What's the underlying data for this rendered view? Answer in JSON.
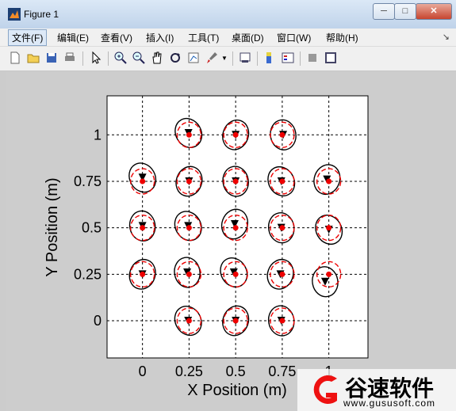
{
  "window": {
    "title": "Figure 1",
    "minimize": "─",
    "maximize": "□",
    "close": "✕"
  },
  "menu": [
    {
      "label": "文件(F)"
    },
    {
      "label": "编辑(E)"
    },
    {
      "label": "查看(V)"
    },
    {
      "label": "插入(I)"
    },
    {
      "label": "工具(T)"
    },
    {
      "label": "桌面(D)"
    },
    {
      "label": "窗口(W)"
    },
    {
      "label": "帮助(H)"
    }
  ],
  "toolbar_icons": [
    "new-icon",
    "open-icon",
    "save-icon",
    "print-icon",
    "pointer-icon",
    "zoom-in-icon",
    "zoom-out-icon",
    "pan-icon",
    "rotate-icon",
    "datacursor-icon",
    "brush-icon",
    "link-icon",
    "colorbar-icon",
    "legend-icon",
    "hide-tools-icon",
    "show-tools-icon"
  ],
  "chart_data": {
    "type": "scatter",
    "xlabel": "X Position (m)",
    "ylabel": "Y Position (m)",
    "xticks": [
      "0",
      "0.25",
      "0.5",
      "0.75",
      "1"
    ],
    "yticks": [
      "0",
      "0.25",
      "0.5",
      "0.75",
      "1"
    ],
    "xlim": [
      -0.19,
      1.21
    ],
    "ylim": [
      -0.2,
      1.21
    ],
    "grid": true,
    "points": [
      {
        "x": 0.25,
        "y": 1.0,
        "tx": 0.247,
        "ty": 1.01
      },
      {
        "x": 0.5,
        "y": 1.0,
        "tx": 0.5,
        "ty": 1.0
      },
      {
        "x": 0.75,
        "y": 1.0,
        "tx": 0.755,
        "ty": 1.0
      },
      {
        "x": 0.0,
        "y": 0.75,
        "tx": 0.0,
        "ty": 0.77
      },
      {
        "x": 0.25,
        "y": 0.75,
        "tx": 0.25,
        "ty": 0.75
      },
      {
        "x": 0.5,
        "y": 0.75,
        "tx": 0.5,
        "ty": 0.75
      },
      {
        "x": 0.75,
        "y": 0.75,
        "tx": 0.745,
        "ty": 0.75
      },
      {
        "x": 1.0,
        "y": 0.75,
        "tx": 0.99,
        "ty": 0.76
      },
      {
        "x": 0.0,
        "y": 0.5,
        "tx": 0.0,
        "ty": 0.51
      },
      {
        "x": 0.25,
        "y": 0.5,
        "tx": 0.245,
        "ty": 0.51
      },
      {
        "x": 0.5,
        "y": 0.5,
        "tx": 0.495,
        "ty": 0.52
      },
      {
        "x": 0.75,
        "y": 0.5,
        "tx": 0.745,
        "ty": 0.5
      },
      {
        "x": 1.0,
        "y": 0.5,
        "tx": 1.0,
        "ty": 0.49
      },
      {
        "x": 0.0,
        "y": 0.25,
        "tx": 0.0,
        "ty": 0.25
      },
      {
        "x": 0.25,
        "y": 0.25,
        "tx": 0.24,
        "ty": 0.26
      },
      {
        "x": 0.5,
        "y": 0.25,
        "tx": 0.49,
        "ty": 0.26
      },
      {
        "x": 0.75,
        "y": 0.25,
        "tx": 0.74,
        "ty": 0.25
      },
      {
        "x": 1.0,
        "y": 0.25,
        "tx": 0.98,
        "ty": 0.21
      },
      {
        "x": 0.25,
        "y": 0.0,
        "tx": 0.245,
        "ty": 0.0
      },
      {
        "x": 0.5,
        "y": 0.0,
        "tx": 0.5,
        "ty": 0.0
      },
      {
        "x": 0.75,
        "y": 0.0,
        "tx": 0.745,
        "ty": 0.0
      }
    ]
  },
  "watermark": {
    "text": "谷速软件",
    "url": "www.gususoft.com"
  }
}
